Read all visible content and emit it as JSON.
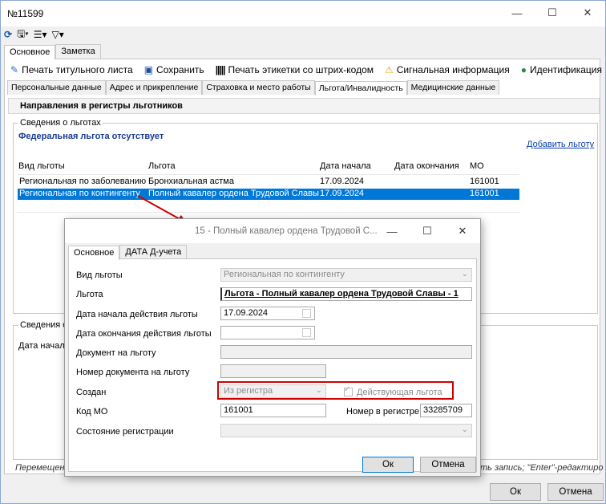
{
  "window": {
    "title": "№11599"
  },
  "toolbar": {
    "refresh_icon": "refresh-icon",
    "save_icon": "save-icon",
    "tree_icon": "tree-icon",
    "filter_icon": "filter-icon"
  },
  "outer_tabs": [
    "Основное",
    "Заметка"
  ],
  "actions": [
    "Печать титульного листа",
    "Сохранить",
    "Печать этикетки со штрих-кодом",
    "Сигнальная информация",
    "Идентификация"
  ],
  "inner_tabs": [
    "Персональные данные",
    "Адрес и прикрепление",
    "Страховка и место работы",
    "Льгота/Инвалидность",
    "Медицинские данные"
  ],
  "section_title": "Направления в регистры льготников",
  "benefits_group": {
    "label": "Сведения о льготах",
    "federal": "Федеральная льгота отсутствует",
    "add_link": "Добавить льготу",
    "columns": [
      "Вид льготы",
      "Льгота",
      "Дата начала",
      "Дата окончания",
      "МО"
    ],
    "rows": [
      [
        "Региональная по заболеванию",
        "Бронхиальная астма",
        "17.09.2024",
        "",
        "161001"
      ],
      [
        "Региональная по контингенту",
        "Полный кавалер ордена Трудовой Славы",
        "17.09.2024",
        "",
        "161001"
      ]
    ]
  },
  "second_group": {
    "label": "Сведения о",
    "column": "Дата начала"
  },
  "status_bar": {
    "left": "Перемещени",
    "right": "ть запись; \"Enter\"-редактиро"
  },
  "main_buttons": {
    "ok": "Ок",
    "cancel": "Отмена"
  },
  "dialog": {
    "title": "15 - Полный кавалер ордена Трудовой С...",
    "tabs": [
      "Основное",
      "ДАТА Д-учета"
    ],
    "fields": {
      "benefit_type_label": "Вид льготы",
      "benefit_type_value": "Региональная по контингенту",
      "benefit_label": "Льгота",
      "benefit_value": "Льгота - Полный кавалер ордена Трудовой Славы - 1",
      "start_label": "Дата начала действия льготы",
      "start_value": "17.09.2024",
      "end_label": "Дата окончания действия льготы",
      "doc_label": "Документ на льготу",
      "docnum_label": "Номер документа на льготу",
      "created_label": "Создан",
      "created_value": "Из регистра",
      "active_label": "Действующая льгота",
      "mo_label": "Код МО",
      "mo_value": "161001",
      "regnum_label": "Номер в регистре",
      "regnum_value": "33285709",
      "regstate_label": "Состояние регистрации"
    },
    "ok": "Ок",
    "cancel": "Отмена"
  }
}
